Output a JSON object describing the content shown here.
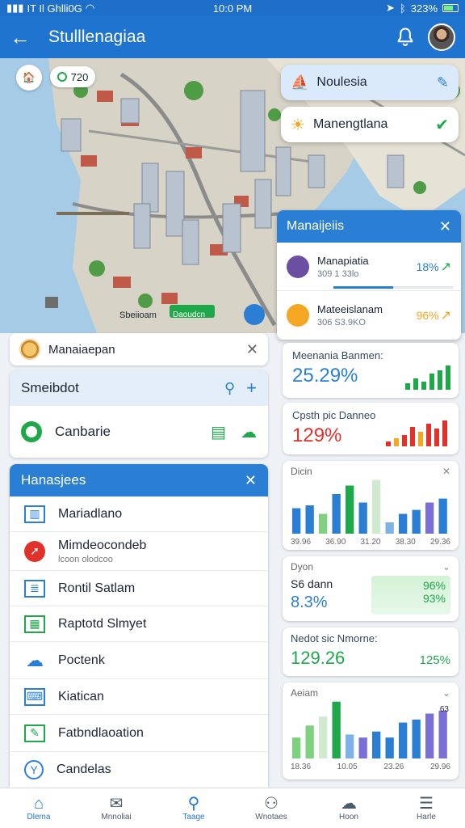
{
  "status_bar": {
    "carrier": "IT Il Ghlli0G",
    "time": "10:0 PM",
    "battery": "323%"
  },
  "app_bar": {
    "title": "Stulllenagiaa"
  },
  "map": {
    "badge_value": "720",
    "labels": [
      "Sbeiioam",
      "Daoudcn"
    ]
  },
  "floating_cards": [
    {
      "label": "Noulesia"
    },
    {
      "label": "Manengtlana"
    }
  ],
  "info_strip": {
    "label": "Manaiaepan"
  },
  "search_card": {
    "header": "Smeibdot",
    "item_label": "Canbarie"
  },
  "menu_panel": {
    "title": "Hanasjees",
    "items": [
      {
        "label": "Mariadlano",
        "sub": ""
      },
      {
        "label": "Mimdeocondeb",
        "sub": "lcoon olodcoo"
      },
      {
        "label": "Rontil  Satlam",
        "sub": ""
      },
      {
        "label": "Raptotd Slmyet",
        "sub": ""
      },
      {
        "label": "Poctenk",
        "sub": ""
      },
      {
        "label": "Kiatican",
        "sub": ""
      },
      {
        "label": "Fatbndlaoation",
        "sub": ""
      },
      {
        "label": "Candelas",
        "sub": ""
      }
    ]
  },
  "right_panel": {
    "title": "Manaijeiis",
    "rows": [
      {
        "title": "Manapiatia",
        "sub": "309 1 33lo",
        "value": "18%"
      },
      {
        "title": "Mateeislanam",
        "sub": "306 S3.9KO",
        "value": "96%"
      }
    ]
  },
  "stats": [
    {
      "label": "Meenania Banmen:",
      "value": "25.29%"
    },
    {
      "label": "Cpsth pic Danneo",
      "value": "129%"
    }
  ],
  "chart_cards": [
    {
      "label": "Dicin",
      "ticks": [
        "39.96",
        "36.90",
        "31.20",
        "38.30",
        "29.36"
      ]
    },
    {
      "label": "Dyon",
      "sub_label": "S6 dann",
      "value": "8.3%",
      "badge_top": "96%",
      "badge_bottom": "93%"
    },
    {
      "label": "Nedot sic Nmorne:",
      "value": "129.26",
      "value_right": "125%"
    },
    {
      "label": "Aeiam",
      "corner_value": "63",
      "ticks": [
        "18.36",
        "10.05",
        "23.26",
        "29.96"
      ]
    }
  ],
  "bottom_nav": [
    {
      "label": "Dlema",
      "icon": "home-icon"
    },
    {
      "label": "Mnnoliai",
      "icon": "mail-icon"
    },
    {
      "label": "Taage",
      "icon": "search-icon"
    },
    {
      "label": "Wnotaes",
      "icon": "people-icon"
    },
    {
      "label": "Hoon",
      "icon": "cloud-icon"
    },
    {
      "label": "Harle",
      "icon": "menu-icon"
    }
  ],
  "colors": {
    "primary": "#1f74cf",
    "green": "#1fa84a",
    "red": "#e0322b",
    "orange": "#f5a623"
  }
}
